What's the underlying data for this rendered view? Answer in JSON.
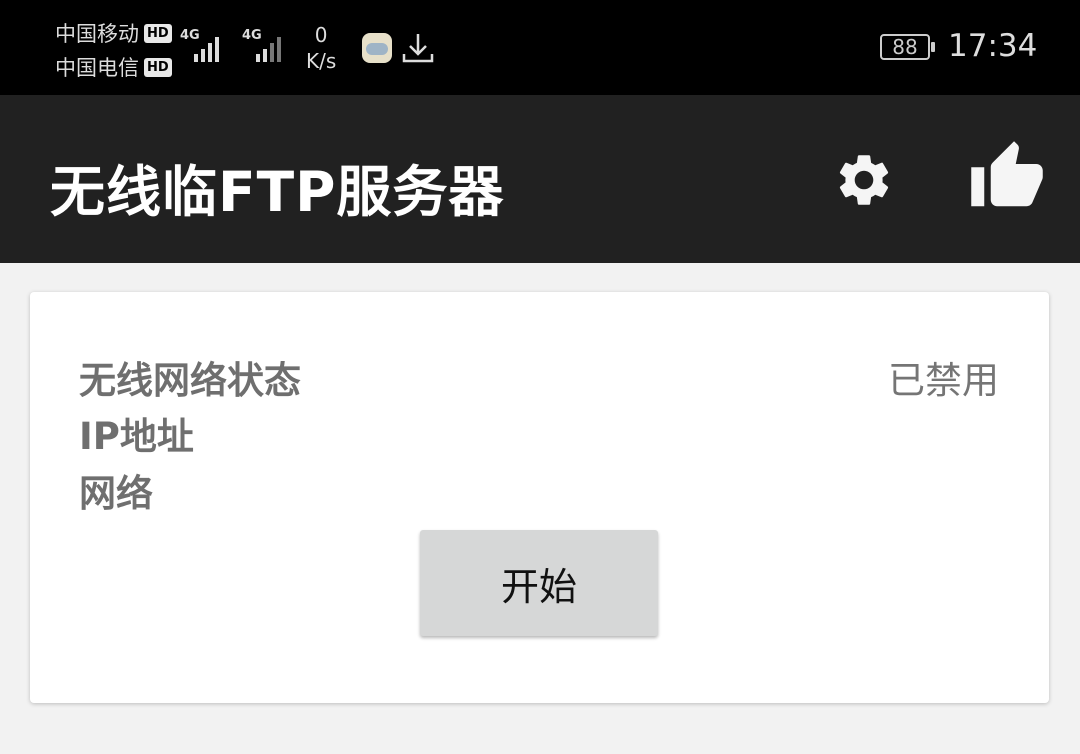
{
  "status_bar": {
    "carrier1": "中国移动",
    "carrier2": "中国电信",
    "hd_badge": "HD",
    "network_type": "4G",
    "speed_value": "0",
    "speed_unit": "K/s",
    "battery": "88",
    "time": "17:34"
  },
  "toolbar": {
    "title": "无线临FTP服务器",
    "settings_icon": "gear-icon",
    "like_icon": "thumbs-up-icon"
  },
  "card": {
    "wifi_status_label": "无线网络状态",
    "wifi_status_value": "已禁用",
    "ip_label": "IP地址",
    "network_label": "网络",
    "start_button": "开始"
  },
  "colors": {
    "status_bar_bg": "#000000",
    "toolbar_bg": "#212121",
    "page_bg": "#f2f2f2",
    "card_bg": "#ffffff",
    "button_bg": "#d6d7d7",
    "label_text": "#6f6f6f"
  }
}
